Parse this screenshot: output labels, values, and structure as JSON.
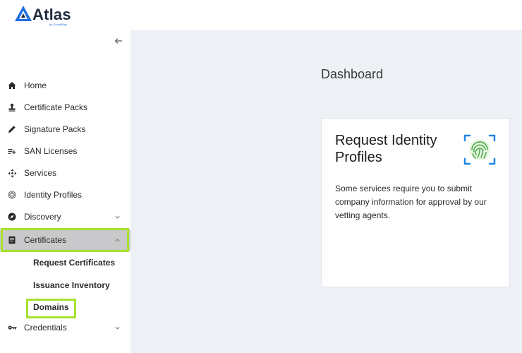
{
  "brand": {
    "name": "Atlas",
    "sub": "by GlobalSign",
    "accent": "#1f6fe0"
  },
  "sidebar": {
    "items": [
      {
        "label": "Home",
        "icon": "home-icon"
      },
      {
        "label": "Certificate Packs",
        "icon": "stamp-icon"
      },
      {
        "label": "Signature Packs",
        "icon": "pen-icon"
      },
      {
        "label": "SAN Licenses",
        "icon": "list-add-icon"
      },
      {
        "label": "Services",
        "icon": "move-arrows-icon"
      },
      {
        "label": "Identity Profiles",
        "icon": "fingerprint-icon"
      },
      {
        "label": "Discovery",
        "icon": "compass-icon",
        "expandable": true
      },
      {
        "label": "Certificates",
        "icon": "document-icon",
        "expandable": true,
        "expanded": true
      },
      {
        "label": "Credentials",
        "icon": "key-icon",
        "expandable": true
      }
    ],
    "certificates_sub": [
      {
        "label": "Request Certificates"
      },
      {
        "label": "Issuance Inventory"
      },
      {
        "label": "Domains"
      }
    ],
    "highlight_color": "#a6e22e"
  },
  "main": {
    "title": "Dashboard",
    "card": {
      "title": "Request Identity Profiles",
      "body": "Some services require you to submit company information for approval by our vetting agents.",
      "icon": "fingerprint-scan-icon"
    }
  }
}
